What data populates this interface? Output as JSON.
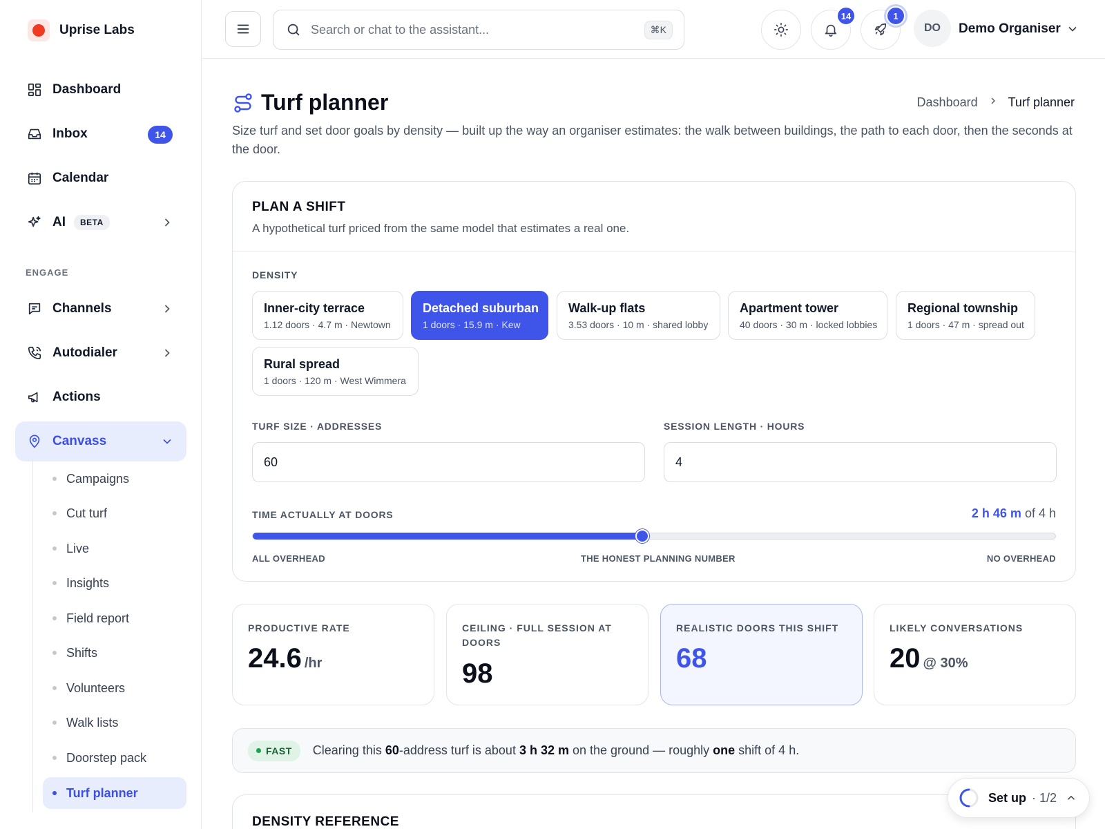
{
  "brand": {
    "name": "Uprise Labs"
  },
  "sidebar": {
    "items": [
      {
        "label": "Dashboard"
      },
      {
        "label": "Inbox",
        "badge": "14"
      },
      {
        "label": "Calendar"
      },
      {
        "label": "AI",
        "tag": "BETA"
      }
    ],
    "section_label": "ENGAGE",
    "engage_items": [
      {
        "label": "Channels"
      },
      {
        "label": "Autodialer"
      },
      {
        "label": "Actions"
      },
      {
        "label": "Canvass"
      }
    ],
    "canvass_sub": [
      {
        "label": "Campaigns"
      },
      {
        "label": "Cut turf"
      },
      {
        "label": "Live"
      },
      {
        "label": "Insights"
      },
      {
        "label": "Field report"
      },
      {
        "label": "Shifts"
      },
      {
        "label": "Volunteers"
      },
      {
        "label": "Walk lists"
      },
      {
        "label": "Doorstep pack"
      },
      {
        "label": "Turf planner"
      }
    ]
  },
  "topbar": {
    "search_placeholder": "Search or chat to the assistant...",
    "shortcut": "⌘K",
    "notifications_count": "14",
    "launch_count": "1",
    "avatar_initials": "DO",
    "user_name": "Demo Organiser"
  },
  "page": {
    "title": "Turf planner",
    "breadcrumb": {
      "parent": "Dashboard",
      "current": "Turf planner"
    },
    "description": "Size turf and set door goals by density — built up the way an organiser estimates: the walk between buildings, the path to each door, then the seconds at the door."
  },
  "plan": {
    "title": "PLAN A SHIFT",
    "subtitle": "A hypothetical turf priced from the same model that estimates a real one.",
    "density_label": "DENSITY",
    "densities": [
      {
        "name": "Inner-city terrace",
        "meta": "1.12 doors · 4.7 m · Newtown"
      },
      {
        "name": "Detached suburban",
        "meta": "1 doors · 15.9 m · Kew"
      },
      {
        "name": "Walk-up flats",
        "meta": "3.53 doors · 10 m · shared lobby"
      },
      {
        "name": "Apartment tower",
        "meta": "40 doors · 30 m · locked lobbies"
      },
      {
        "name": "Regional township",
        "meta": "1 doors · 47 m · spread out"
      },
      {
        "name": "Rural spread",
        "meta": "1 doors · 120 m · West Wimmera"
      }
    ],
    "selected_density": "Detached suburban",
    "turf_size_label": "TURF SIZE · ADDRESSES",
    "turf_size_value": "60",
    "session_label": "SESSION LENGTH · HOURS",
    "session_value": "4",
    "slider": {
      "label": "TIME ACTUALLY AT DOORS",
      "value_text": "2 h 46 m",
      "of_text": "of 4 h",
      "fraction": 0.485,
      "left_caption": "ALL OVERHEAD",
      "mid_caption": "THE HONEST PLANNING NUMBER",
      "right_caption": "NO OVERHEAD"
    }
  },
  "stats": [
    {
      "label": "PRODUCTIVE RATE",
      "value": "24.6",
      "unit": "/hr"
    },
    {
      "label": "CEILING · FULL SESSION AT DOORS",
      "value": "98",
      "unit": ""
    },
    {
      "label": "REALISTIC DOORS THIS SHIFT",
      "value": "68",
      "unit": ""
    },
    {
      "label": "LIKELY CONVERSATIONS",
      "value": "20",
      "unit": "@ 30%"
    }
  ],
  "banner": {
    "pill": "FAST",
    "t1": "Clearing this ",
    "b1": "60",
    "t2": "-address turf is about ",
    "b2": "3 h 32 m",
    "t3": " on the ground — roughly ",
    "b3": "one",
    "t4": " shift of 4 h."
  },
  "reference": {
    "title": "DENSITY REFERENCE"
  },
  "setup": {
    "label": "Set up",
    "progress": "· 1/2"
  },
  "colors": {
    "accent": "#3f55e9",
    "brand": "#ee3b22",
    "success": "#16a34a"
  }
}
